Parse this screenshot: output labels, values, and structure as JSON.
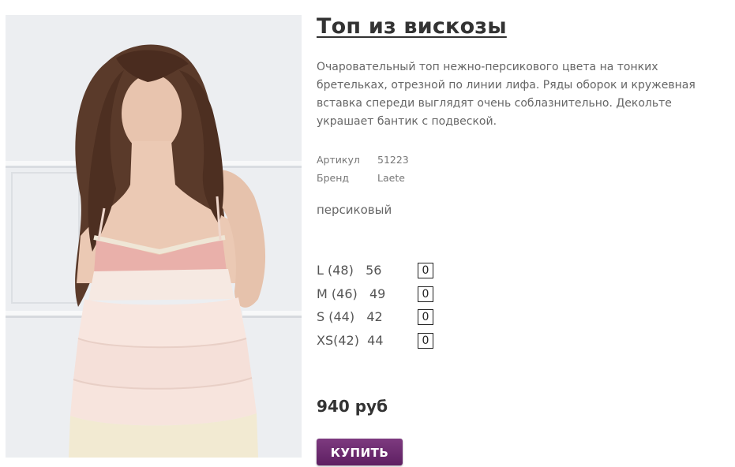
{
  "product": {
    "title": "Топ из вискозы",
    "description": "Очаровательный топ нежно-персикового цвета на тонких бретельках, отрезной по линии лифа. Ряды оборок и кружевная вставка спереди выглядят очень соблазнительно. Декольте украшает бантик с подвеской.",
    "article_label": "Артикул",
    "article_value": "51223",
    "brand_label": "Бренд",
    "brand_value": "Laete",
    "color": "персиковый",
    "sizes": [
      {
        "label": "L (48)   56",
        "qty": "0"
      },
      {
        "label": "M (46)   49",
        "qty": "0"
      },
      {
        "label": "S (44)   42",
        "qty": "0"
      },
      {
        "label": "XS(42)  44",
        "qty": "0"
      }
    ],
    "price": "940 руб",
    "buy_label": "КУПИТЬ"
  },
  "colors": {
    "buy_button": "#6b2a6e",
    "title": "#333333"
  }
}
